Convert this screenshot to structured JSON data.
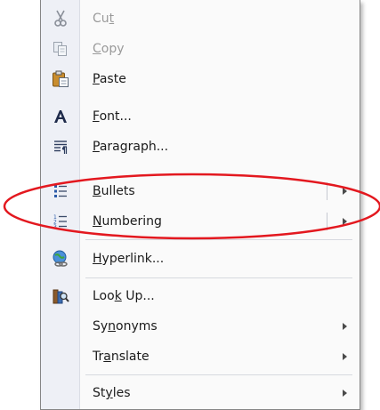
{
  "menu": {
    "items": [
      {
        "pre": "Cu",
        "acc": "t",
        "post": "",
        "icon": "scissors-icon",
        "disabled": true,
        "submenu": false,
        "split": false
      },
      {
        "pre": "",
        "acc": "C",
        "post": "opy",
        "icon": "copy-icon",
        "disabled": true,
        "submenu": false,
        "split": false
      },
      {
        "pre": "",
        "acc": "P",
        "post": "aste",
        "icon": "paste-icon",
        "disabled": false,
        "submenu": false,
        "split": false
      },
      {
        "pre": "",
        "acc": "F",
        "post": "ont...",
        "icon": "font-icon",
        "disabled": false,
        "submenu": false,
        "split": false
      },
      {
        "pre": "",
        "acc": "P",
        "post": "aragraph...",
        "icon": "paragraph-icon",
        "disabled": false,
        "submenu": false,
        "split": false
      },
      {
        "pre": "",
        "acc": "B",
        "post": "ullets",
        "icon": "bullets-icon",
        "disabled": false,
        "submenu": true,
        "split": true
      },
      {
        "pre": "",
        "acc": "N",
        "post": "umbering",
        "icon": "numbering-icon",
        "disabled": false,
        "submenu": true,
        "split": true
      },
      {
        "pre": "",
        "acc": "H",
        "post": "yperlink...",
        "icon": "hyperlink-icon",
        "disabled": false,
        "submenu": false,
        "split": false
      },
      {
        "pre": "Loo",
        "acc": "k",
        "post": " Up...",
        "icon": "research-icon",
        "disabled": false,
        "submenu": false,
        "split": false
      },
      {
        "pre": "Sy",
        "acc": "n",
        "post": "onyms",
        "icon": "",
        "disabled": false,
        "submenu": true,
        "split": false
      },
      {
        "pre": "Tr",
        "acc": "a",
        "post": "nslate",
        "icon": "",
        "disabled": false,
        "submenu": true,
        "split": false
      },
      {
        "pre": "St",
        "acc": "y",
        "post": "les",
        "icon": "",
        "disabled": false,
        "submenu": true,
        "split": false
      }
    ]
  },
  "colors": {
    "highlight_ellipse": "#e3181f",
    "gutter": "#eef0f6",
    "menu_bg": "#fafafa"
  }
}
